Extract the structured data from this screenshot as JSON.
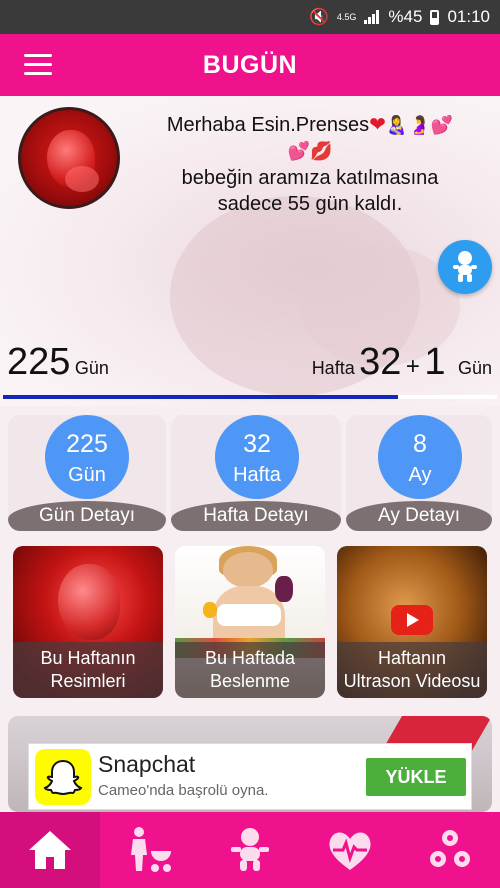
{
  "status_bar": {
    "network": "4.5G",
    "battery": "%45",
    "time": "01:10"
  },
  "app_bar": {
    "title": "BUGÜN"
  },
  "greeting": {
    "line1": "Merhaba Esin.Prenses",
    "emojis1": "👩‍🍼🤰💕",
    "emojis2": "💕💋",
    "line3": "bebeğin aramıza katılmasına",
    "line4": "sadece 55 gün kaldı."
  },
  "counter": {
    "days": "225",
    "days_unit": "Gün",
    "week_label": "Hafta",
    "weeks": "32",
    "plus": "+",
    "extra_days": "1",
    "extra_unit": "Gün",
    "progress": 0.8
  },
  "stats": [
    {
      "value": "225",
      "unit": "Gün",
      "label": "Gün Detayı"
    },
    {
      "value": "32",
      "unit": "Hafta",
      "label": "Hafta Detayı"
    },
    {
      "value": "8",
      "unit": "Ay",
      "label": "Ay Detayı"
    }
  ],
  "tiles": [
    {
      "line1": "Bu Haftanın",
      "line2": "Resimleri"
    },
    {
      "line1": "Bu Haftada",
      "line2": "Beslenme"
    },
    {
      "line1": "Haftanın",
      "line2": "Ultrason Videosu"
    }
  ],
  "ad": {
    "name": "Snapchat",
    "subtitle": "Cameo'nda başrolü oyna.",
    "button": "YÜKLE"
  },
  "bottom_nav": [
    {
      "icon": "home-icon"
    },
    {
      "icon": "mother-stroller-icon"
    },
    {
      "icon": "baby-icon"
    },
    {
      "icon": "heartbeat-icon"
    },
    {
      "icon": "settings-icon"
    }
  ],
  "colors": {
    "primary": "#f0128d",
    "accent_blue": "#4f97f6",
    "progress": "#1327b8"
  }
}
